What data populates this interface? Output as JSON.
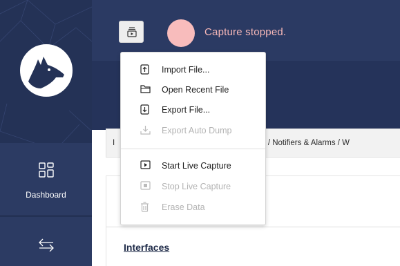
{
  "sidebar": {
    "items": [
      {
        "label": "Dashboard",
        "icon": "dashboard-grid-icon"
      },
      {
        "label": "",
        "icon": "swap-arrows-icon"
      }
    ],
    "logo": "dog-head-logo"
  },
  "header": {
    "capture_button_icon": "capture-file-icon",
    "status": "Capture stopped.",
    "status_color": "#f8bcbc"
  },
  "breadcrumb": {
    "start": "I",
    "text": "ure  /  Notifiers & Alarms  /  W"
  },
  "main": {
    "section_title": "Interfaces"
  },
  "menu": {
    "items": [
      {
        "label": "Import File...",
        "icon": "import-file-icon",
        "enabled": true
      },
      {
        "label": "Open Recent File",
        "icon": "folder-icon",
        "enabled": true
      },
      {
        "label": "Export File...",
        "icon": "export-file-icon",
        "enabled": true
      },
      {
        "label": "Export Auto Dump",
        "icon": "download-icon",
        "enabled": false
      },
      {
        "label": "Start Live Capture",
        "icon": "play-icon",
        "enabled": true
      },
      {
        "label": "Stop Live Capture",
        "icon": "stop-icon",
        "enabled": false
      },
      {
        "label": "Erase Data",
        "icon": "trash-icon",
        "enabled": false
      }
    ]
  },
  "colors": {
    "sidebar": "#243256",
    "header": "#2b3a63",
    "accent_text": "#1e2a48"
  }
}
